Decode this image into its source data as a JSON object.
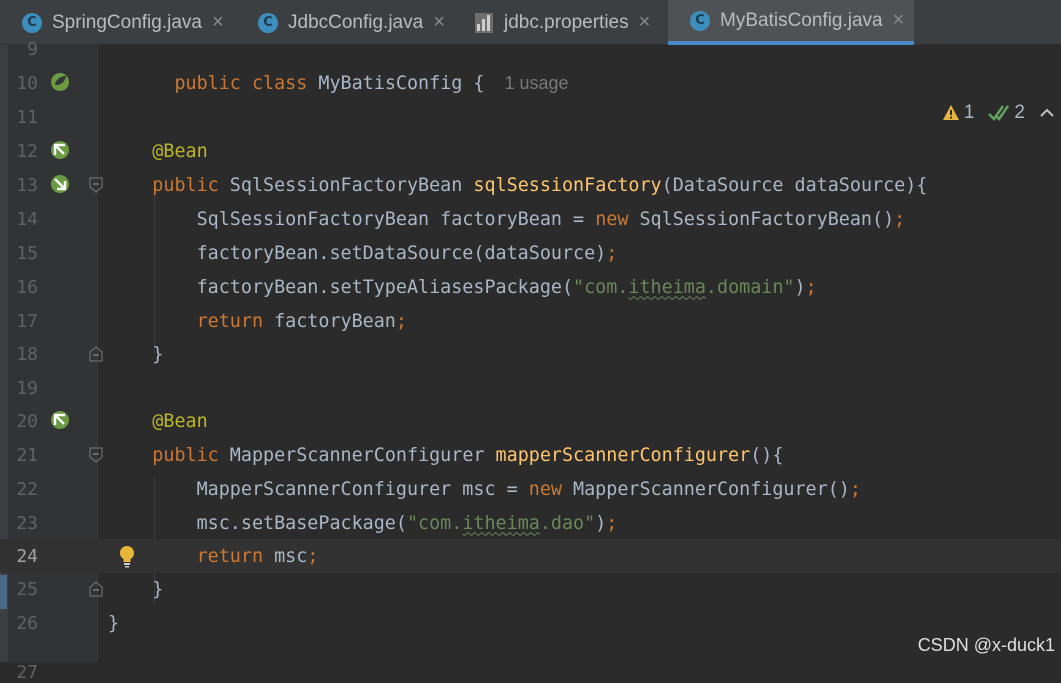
{
  "tabs": [
    {
      "label": "SpringConfig.java",
      "icon": "c",
      "active": false
    },
    {
      "label": "JdbcConfig.java",
      "icon": "c",
      "active": false
    },
    {
      "label": "jdbc.properties",
      "icon": "properties",
      "active": false
    },
    {
      "label": "MyBatisConfig.java",
      "icon": "c",
      "active": true
    }
  ],
  "tab_icon_letter": "C",
  "close_glyph": "×",
  "inspections": {
    "warnings": "1",
    "passed": "2"
  },
  "usage_hint": "1 usage",
  "line_numbers": [
    "9",
    "10",
    "11",
    "12",
    "13",
    "14",
    "15",
    "16",
    "17",
    "18",
    "19",
    "20",
    "21",
    "22",
    "23",
    "24",
    "25",
    "26",
    "27"
  ],
  "current_line": "24",
  "code": {
    "l10": {
      "kw1": "public",
      "kw2": "class",
      "name": "MyBatisConfig",
      "brace": " {"
    },
    "l12": {
      "ann": "@Bean"
    },
    "l13": {
      "kw": "public",
      "type": " SqlSessionFactoryBean ",
      "fn": "sqlSessionFactory",
      "params": "(DataSource dataSource){"
    },
    "l14": {
      "a": "SqlSessionFactoryBean factoryBean = ",
      "kw": "new",
      "b": " SqlSessionFactoryBean()",
      "semi": ";"
    },
    "l15": {
      "a": "factoryBean.setDataSource(dataSource)",
      "semi": ";"
    },
    "l16": {
      "a": "factoryBean.setTypeAliasesPackage(",
      "s1": "\"com.",
      "s2": "itheima",
      "s3": ".domain\"",
      "b": ")",
      "semi": ";"
    },
    "l17": {
      "kw": "return",
      "a": " factoryBean",
      "semi": ";"
    },
    "l18": {
      "a": "}"
    },
    "l20": {
      "ann": "@Bean"
    },
    "l21": {
      "kw": "public",
      "type": " MapperScannerConfigurer ",
      "fn": "mapperScannerConfigurer",
      "params": "(){"
    },
    "l22": {
      "a": "MapperScannerConfigurer msc = ",
      "kw": "new",
      "b": " MapperScannerConfigurer()",
      "semi": ";"
    },
    "l23": {
      "a": "msc.setBasePackage(",
      "s1": "\"com.",
      "s2": "itheima",
      "s3": ".dao\"",
      "b": ")",
      "semi": ";"
    },
    "l24": {
      "kw": "return",
      "a": " msc",
      "semi": ";"
    },
    "l25": {
      "a": "}"
    },
    "l26": {
      "a": "}"
    }
  },
  "watermark": "CSDN @x-duck1",
  "colors": {
    "keyword": "#cc7832",
    "annotation": "#bbb529",
    "method": "#ffc66d",
    "string": "#6a8759",
    "text": "#a9b7c6",
    "accent": "#4a88c7"
  }
}
